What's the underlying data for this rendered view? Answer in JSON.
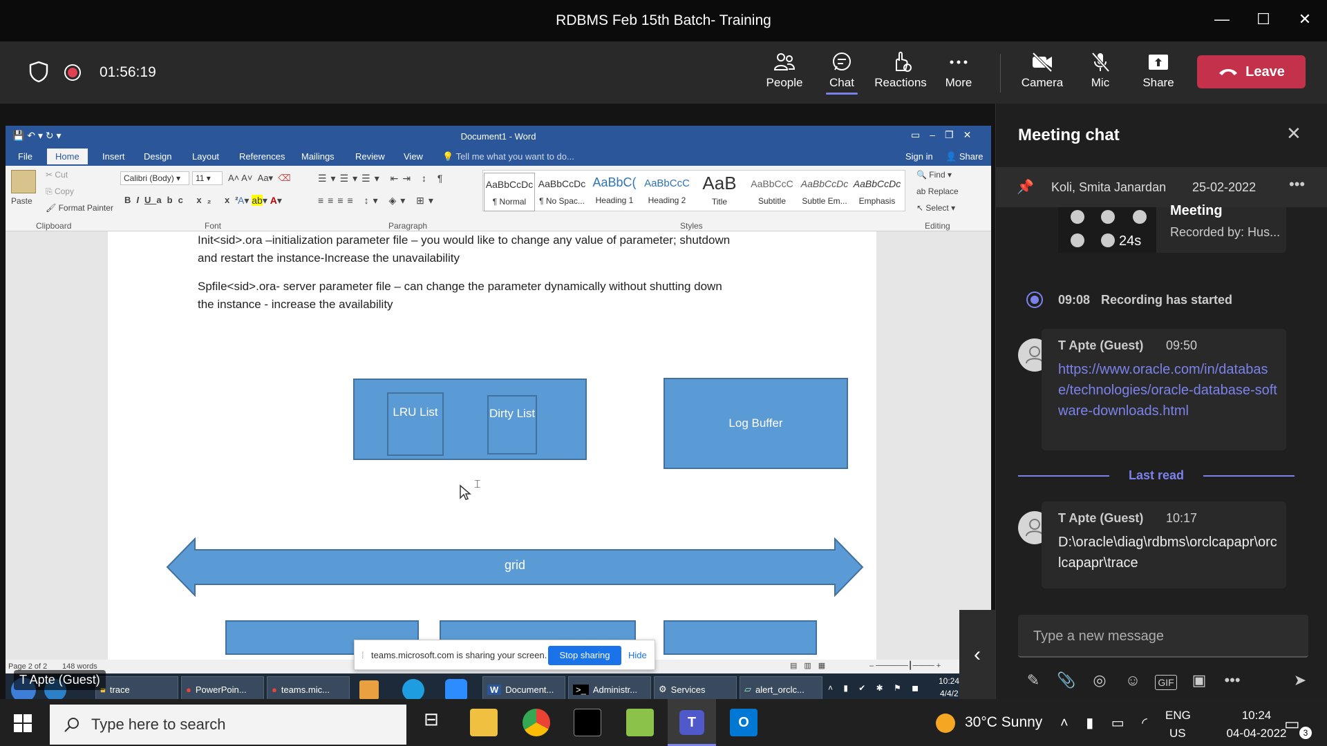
{
  "window": {
    "title": "RDBMS Feb 15th Batch- Training"
  },
  "meeting": {
    "elapsed": "01:56:19",
    "buttons": {
      "people": "People",
      "chat": "Chat",
      "reactions": "Reactions",
      "more": "More",
      "camera": "Camera",
      "mic": "Mic",
      "share": "Share",
      "leave": "Leave"
    }
  },
  "word": {
    "title": "Document1 - Word",
    "tabs": [
      "File",
      "Home",
      "Insert",
      "Design",
      "Layout",
      "References",
      "Mailings",
      "Review",
      "View"
    ],
    "tell_me": "Tell me what you want to do...",
    "sign_in": "Sign in",
    "share": "Share",
    "clipboard": {
      "cut": "Cut",
      "copy": "Copy",
      "paste": "Paste",
      "format_painter": "Format Painter",
      "group": "Clipboard"
    },
    "font": {
      "name": "Calibri (Body)",
      "size": "11",
      "group": "Font"
    },
    "paragraph_group": "Paragraph",
    "styles": [
      {
        "preview": "AaBbCcDc",
        "name": "¶ Normal"
      },
      {
        "preview": "AaBbCcDc",
        "name": "¶ No Spac..."
      },
      {
        "preview": "AaBbC(",
        "name": "Heading 1"
      },
      {
        "preview": "AaBbCcC",
        "name": "Heading 2"
      },
      {
        "preview": "AaB",
        "name": "Title"
      },
      {
        "preview": "AaBbCcC",
        "name": "Subtitle"
      },
      {
        "preview": "AaBbCcDc",
        "name": "Subtle Em..."
      },
      {
        "preview": "AaBbCcDc",
        "name": "Emphasis"
      }
    ],
    "styles_group": "Styles",
    "editing": {
      "find": "Find",
      "replace": "Replace",
      "select": "Select",
      "group": "Editing"
    },
    "doc": {
      "para1_line1": "Init<sid>.ora –initialization parameter file – you would like to change any value of parameter; shutdown",
      "para1_line2": "and restart the instance-Increase the unavailability",
      "para2_line1": "Spfile<sid>.ora- server parameter file – can change the parameter dynamically without shutting down",
      "para2_line2": "the instance  - increase the availability",
      "lru": "LRU List",
      "dirty": "Dirty List",
      "log_buffer": "Log Buffer",
      "grid": "grid"
    },
    "status": {
      "page": "Page 2 of 2",
      "words": "148 words"
    }
  },
  "share_banner": {
    "text": "teams.microsoft.com is sharing your screen.",
    "stop": "Stop sharing",
    "hide": "Hide"
  },
  "remote_taskbar": {
    "items": [
      "trace",
      "PowerPoin...",
      "teams.mic...",
      "Document...",
      "Administr...",
      "Services",
      "alert_orclc..."
    ],
    "time": "10:24",
    "date": "4/4/2"
  },
  "guest_label": "T Apte (Guest)",
  "chat": {
    "title": "Meeting chat",
    "pinned_name": "Koli, Smita Janardan",
    "pinned_date": "25-02-2022",
    "recording_card": {
      "title": "Meeting",
      "by": "Recorded by: Hus...",
      "duration": "24s"
    },
    "recording_time": "09:08",
    "recording_text": "Recording has started",
    "messages": [
      {
        "author": "T Apte (Guest)",
        "time": "09:50",
        "text": "https://www.oracle.com/in/database/technologies/oracle-database-software-downloads.html"
      },
      {
        "author": "T Apte (Guest)",
        "time": "10:17",
        "text": "D:\\oracle\\diag\\rdbms\\orclcapapr\\orclcapapr\\trace"
      }
    ],
    "last_read": "Last read",
    "compose_placeholder": "Type a new message"
  },
  "taskbar": {
    "search_placeholder": "Type here to search",
    "weather": "30°C  Sunny",
    "lang1": "ENG",
    "lang2": "US",
    "time": "10:24",
    "date": "04-04-2022",
    "notif_count": "3"
  }
}
